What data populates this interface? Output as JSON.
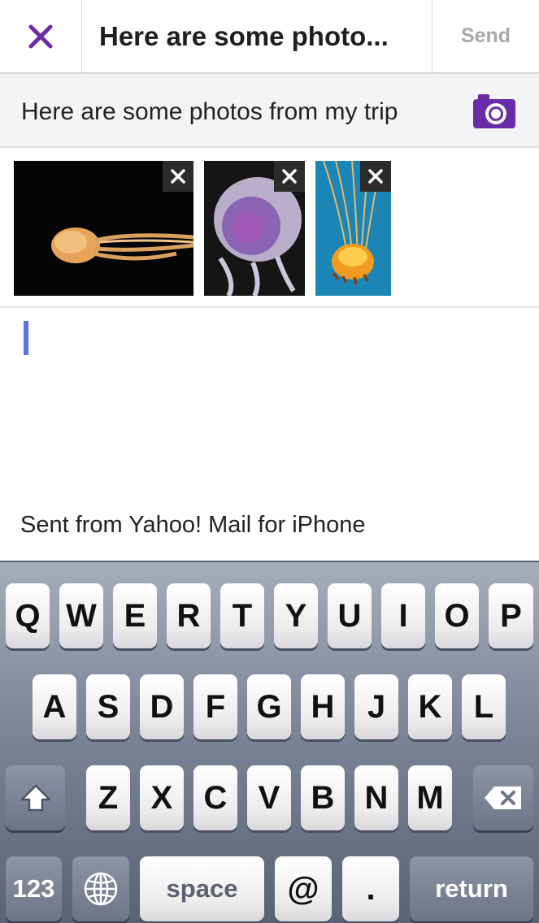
{
  "header": {
    "title": "Here are some photo...",
    "send_label": "Send"
  },
  "subject": {
    "text": "Here are some photos from my trip"
  },
  "attachments": [
    {
      "name": "jellyfish-orange-dark"
    },
    {
      "name": "jellyfish-purple"
    },
    {
      "name": "jellyfish-orange-blue"
    }
  ],
  "signature": "Sent from Yahoo! Mail for iPhone",
  "keyboard": {
    "row1": [
      "Q",
      "W",
      "E",
      "R",
      "T",
      "Y",
      "U",
      "I",
      "O",
      "P"
    ],
    "row2": [
      "A",
      "S",
      "D",
      "F",
      "G",
      "H",
      "J",
      "K",
      "L"
    ],
    "row3": [
      "Z",
      "X",
      "C",
      "V",
      "B",
      "N",
      "M"
    ],
    "numbers": "123",
    "space": "space",
    "at": "@",
    "dot": ".",
    "return": "return"
  },
  "colors": {
    "accent": "#6b2aa8",
    "cursor": "#5a72e6"
  }
}
